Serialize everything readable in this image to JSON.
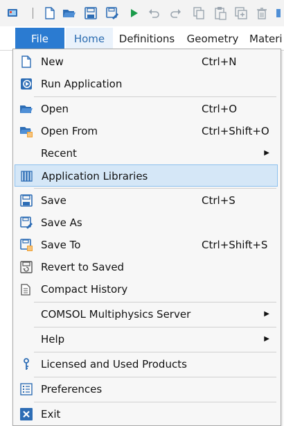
{
  "toolbar": {
    "icons": [
      "app-icon",
      "new-icon",
      "open-icon",
      "save-icon",
      "save-as-icon",
      "run-icon",
      "undo-icon",
      "redo-icon",
      "copy-icon",
      "paste-icon",
      "duplicate-icon",
      "delete-icon",
      "more-icon"
    ]
  },
  "tabs": [
    {
      "label": "File"
    },
    {
      "label": "Home"
    },
    {
      "label": "Definitions"
    },
    {
      "label": "Geometry"
    },
    {
      "label": "Materi"
    }
  ],
  "menu": {
    "items": [
      {
        "label": "New",
        "shortcut": "Ctrl+N"
      },
      {
        "label": "Run Application",
        "shortcut": ""
      },
      {
        "label": "Open",
        "shortcut": "Ctrl+O"
      },
      {
        "label": "Open From",
        "shortcut": "Ctrl+Shift+O"
      },
      {
        "label": "Recent",
        "shortcut": "",
        "arrow": "▶"
      },
      {
        "label": "Application Libraries",
        "shortcut": ""
      },
      {
        "label": "Save",
        "shortcut": "Ctrl+S"
      },
      {
        "label": "Save As",
        "shortcut": ""
      },
      {
        "label": "Save To",
        "shortcut": "Ctrl+Shift+S"
      },
      {
        "label": "Revert to Saved",
        "shortcut": ""
      },
      {
        "label": "Compact History",
        "shortcut": ""
      },
      {
        "label": "COMSOL Multiphysics Server",
        "shortcut": "",
        "arrow": "▶"
      },
      {
        "label": "Help",
        "shortcut": "",
        "arrow": "▶"
      },
      {
        "label": "Licensed and Used Products",
        "shortcut": ""
      },
      {
        "label": "Preferences",
        "shortcut": ""
      },
      {
        "label": "Exit",
        "shortcut": ""
      }
    ]
  },
  "colors": {
    "accent": "#2b7bd1",
    "highlight": "#d5e7f7",
    "highlight_border": "#8dc0ee",
    "icon_blue": "#2d6db5",
    "icon_green": "#1a9b4a",
    "icon_orange": "#f0a030"
  }
}
